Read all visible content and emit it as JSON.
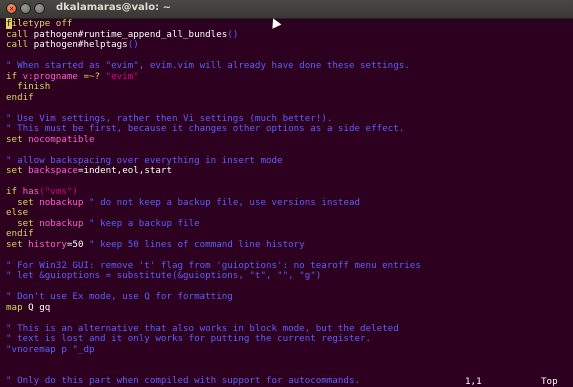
{
  "window": {
    "title": "dkalamaras@valo: ~"
  },
  "icons": {
    "close": "close-icon",
    "minimize": "minimize-icon",
    "maximize": "maximize-icon",
    "pointer": "mouse-pointer-icon"
  },
  "lines": [
    [
      {
        "t": "f",
        "c": "cur"
      },
      {
        "t": "iletype off",
        "c": "kw"
      }
    ],
    [
      {
        "t": "call ",
        "c": "kw"
      },
      {
        "t": "pathogen#runtime_append_all_bundles",
        "c": "nm"
      },
      {
        "t": "()",
        "c": "cm"
      }
    ],
    [
      {
        "t": "call ",
        "c": "kw"
      },
      {
        "t": "pathogen#helptags",
        "c": "nm"
      },
      {
        "t": "()",
        "c": "cm"
      }
    ],
    [
      {
        "t": "",
        "c": "nm"
      }
    ],
    [
      {
        "t": "\" When started as \"evim\", evim.vim will already have done these settings.",
        "c": "cm"
      }
    ],
    [
      {
        "t": "if ",
        "c": "kw"
      },
      {
        "t": "v:progname ",
        "c": "sp"
      },
      {
        "t": "=~? ",
        "c": "op"
      },
      {
        "t": "\"evim\"",
        "c": "str"
      }
    ],
    [
      {
        "t": "  finish",
        "c": "kw"
      }
    ],
    [
      {
        "t": "endif",
        "c": "kw"
      }
    ],
    [
      {
        "t": "",
        "c": "nm"
      }
    ],
    [
      {
        "t": "\" Use Vim settings, rather then Vi settings (much better!).",
        "c": "cm"
      }
    ],
    [
      {
        "t": "\" This must be first, because it changes other options as a side effect.",
        "c": "cm"
      }
    ],
    [
      {
        "t": "set ",
        "c": "kw"
      },
      {
        "t": "nocompatible",
        "c": "sp"
      }
    ],
    [
      {
        "t": "",
        "c": "nm"
      }
    ],
    [
      {
        "t": "\" allow backspacing over everything in insert mode",
        "c": "cm"
      }
    ],
    [
      {
        "t": "set ",
        "c": "kw"
      },
      {
        "t": "backspace",
        "c": "sp"
      },
      {
        "t": "=indent,eol,start",
        "c": "nm"
      }
    ],
    [
      {
        "t": "",
        "c": "nm"
      }
    ],
    [
      {
        "t": "if ",
        "c": "kw"
      },
      {
        "t": "has",
        "c": "sp"
      },
      {
        "t": "(\"vms\")",
        "c": "str"
      }
    ],
    [
      {
        "t": "  set ",
        "c": "kw"
      },
      {
        "t": "nobackup ",
        "c": "sp"
      },
      {
        "t": "\" do not keep a backup file, use versions instead",
        "c": "cm"
      }
    ],
    [
      {
        "t": "else",
        "c": "kw"
      }
    ],
    [
      {
        "t": "  set ",
        "c": "kw"
      },
      {
        "t": "nobackup ",
        "c": "sp"
      },
      {
        "t": "\" keep a backup file",
        "c": "cm"
      }
    ],
    [
      {
        "t": "endif",
        "c": "kw"
      }
    ],
    [
      {
        "t": "set ",
        "c": "kw"
      },
      {
        "t": "history",
        "c": "sp"
      },
      {
        "t": "=50 ",
        "c": "nm"
      },
      {
        "t": "\" keep 50 lines of command line history",
        "c": "cm"
      }
    ],
    [
      {
        "t": "",
        "c": "nm"
      }
    ],
    [
      {
        "t": "\" For Win32 GUI: remove 't' flag from 'guioptions': no tearoff menu entries",
        "c": "cm"
      }
    ],
    [
      {
        "t": "\" let &guioptions = substitute(&guioptions, \"t\", \"\", \"g\")",
        "c": "cm"
      }
    ],
    [
      {
        "t": "",
        "c": "nm"
      }
    ],
    [
      {
        "t": "\" Don't use Ex mode, use Q for formatting",
        "c": "cm"
      }
    ],
    [
      {
        "t": "map ",
        "c": "kw"
      },
      {
        "t": "Q gq",
        "c": "nm"
      }
    ],
    [
      {
        "t": "",
        "c": "nm"
      }
    ],
    [
      {
        "t": "\" This is an alternative that also works in block mode, but the deleted",
        "c": "cm"
      }
    ],
    [
      {
        "t": "\" text is lost and it only works for putting the current register.",
        "c": "cm"
      }
    ],
    [
      {
        "t": "\"vnoremap p \"_dp",
        "c": "cm"
      }
    ],
    [
      {
        "t": "",
        "c": "nm"
      }
    ],
    [
      {
        "t": "",
        "c": "nm"
      }
    ],
    [
      {
        "t": "\" Only do this part when compiled with support for autocommands.",
        "c": "cm"
      }
    ]
  ],
  "statusbar": {
    "position": "1,1",
    "scroll": "Top"
  }
}
